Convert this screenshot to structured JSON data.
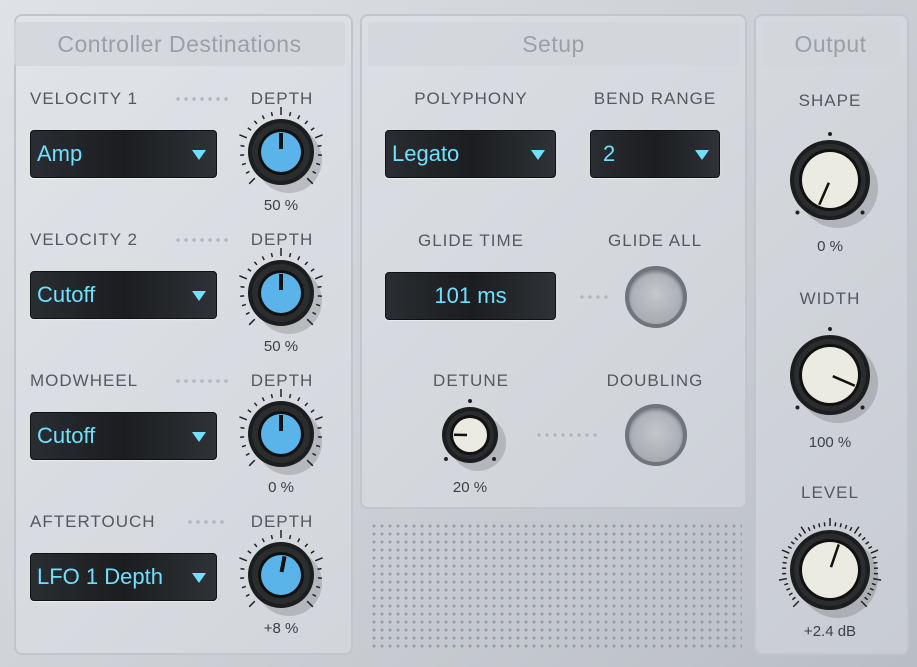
{
  "panels": {
    "controller": "Controller Destinations",
    "setup": "Setup",
    "output": "Output"
  },
  "controller_rows": [
    {
      "label": "VELOCITY 1",
      "depth_label": "DEPTH",
      "destination": "Amp",
      "depth_value": "50 %",
      "knob_position": 0.5
    },
    {
      "label": "VELOCITY 2",
      "depth_label": "DEPTH",
      "destination": "Cutoff",
      "depth_value": "50 %",
      "knob_position": 0.5
    },
    {
      "label": "MODWHEEL",
      "depth_label": "DEPTH",
      "destination": "Cutoff",
      "depth_value": "0 %",
      "knob_position": 0.5
    },
    {
      "label": "AFTERTOUCH",
      "depth_label": "DEPTH",
      "destination": "LFO 1 Depth",
      "depth_value": "+8 %",
      "knob_position": 0.54
    }
  ],
  "setup": {
    "polyphony_label": "POLYPHONY",
    "polyphony_value": "Legato",
    "bend_range_label": "BEND RANGE",
    "bend_range_value": "2",
    "glide_time_label": "GLIDE TIME",
    "glide_time_value": "101 ms",
    "glide_all_label": "GLIDE ALL",
    "detune_label": "DETUNE",
    "detune_value": "20 %",
    "detune_position": 0.17,
    "doubling_label": "DOUBLING"
  },
  "output": {
    "shape_label": "SHAPE",
    "shape_value": "0 %",
    "shape_position": -0.08,
    "width_label": "WIDTH",
    "width_value": "100 %",
    "width_position": 0.92,
    "level_label": "LEVEL",
    "level_value": "+2.4 dB",
    "level_position": 0.57
  },
  "colors": {
    "accent": "#6fe0ff",
    "knob_blue": "#5ab4ea",
    "knob_cream": "#ecebe2"
  }
}
